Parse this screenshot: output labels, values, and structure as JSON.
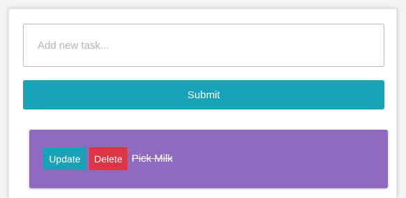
{
  "form": {
    "input_placeholder": "Add new task...",
    "input_value": "",
    "submit_label": "Submit"
  },
  "tasks": [
    {
      "update_label": "Update",
      "delete_label": "Delete",
      "text": "Pick Milk",
      "completed": true
    }
  ],
  "colors": {
    "primary": "#17a2b8",
    "danger": "#dc3545",
    "task_bg": "#8e6bbf"
  }
}
